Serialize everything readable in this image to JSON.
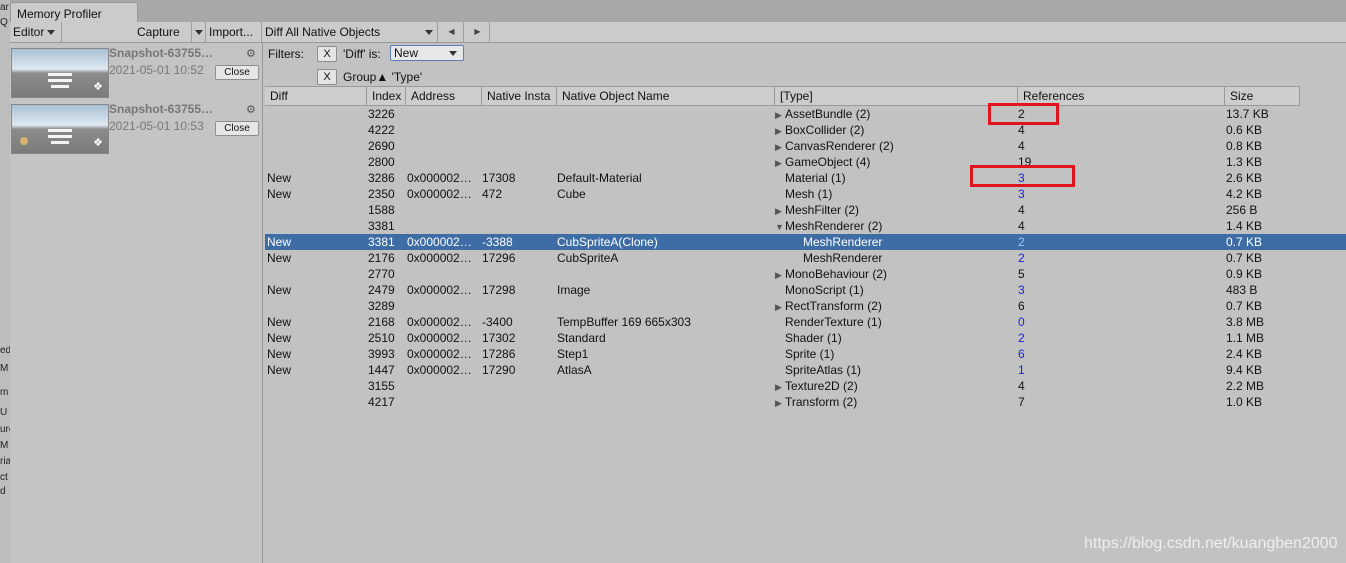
{
  "left_strip_fragments": [
    "ar",
    "Q",
    "ed",
    "M",
    "m",
    "U",
    "ure",
    "M",
    "ria",
    "ct",
    "d"
  ],
  "window": {
    "tab_title": "Memory Profiler"
  },
  "toolbar": {
    "editor_label": "Editor",
    "capture_label": "Capture",
    "import_label": "Import...",
    "view_select": "Diff All Native Objects",
    "prev_icon": "triangle-left-icon",
    "next_icon": "triangle-right-icon"
  },
  "snapshots": [
    {
      "name": "Snapshot-63755…",
      "date": "2021-05-01 10:52",
      "close_label": "Close"
    },
    {
      "name": "Snapshot-63755…",
      "date": "2021-05-01 10:53",
      "close_label": "Close"
    }
  ],
  "filters": {
    "label": "Filters:",
    "remove_label": "X",
    "diff_label": "'Diff' is:",
    "diff_value": "New",
    "group_label": "Group▲ 'Type'"
  },
  "table": {
    "columns": [
      "Diff",
      "Index",
      "Address",
      "Native Insta",
      "Native Object Name",
      "[Type]",
      "References",
      "Size"
    ],
    "rows": [
      {
        "diff": "",
        "index": "3226",
        "address": "",
        "instance": "",
        "name": "",
        "fold": "closed",
        "type": "AssetBundle (2)",
        "refs": "2",
        "size": "13.7 KB"
      },
      {
        "diff": "",
        "index": "4222",
        "address": "",
        "instance": "",
        "name": "",
        "fold": "closed",
        "type": "BoxCollider (2)",
        "refs": "4",
        "size": "0.6 KB"
      },
      {
        "diff": "",
        "index": "2690",
        "address": "",
        "instance": "",
        "name": "",
        "fold": "closed",
        "type": "CanvasRenderer (2)",
        "refs": "4",
        "size": "0.8 KB"
      },
      {
        "diff": "",
        "index": "2800",
        "address": "",
        "instance": "",
        "name": "",
        "fold": "closed",
        "type": "GameObject (4)",
        "refs": "19",
        "size": "1.3 KB"
      },
      {
        "diff": "New",
        "index": "3286",
        "address": "0x000002…",
        "instance": "17308",
        "name": "Default-Material",
        "fold": "",
        "type": "Material (1)",
        "refs": "3",
        "refs_link": true,
        "size": "2.6 KB"
      },
      {
        "diff": "New",
        "index": "2350",
        "address": "0x000002…",
        "instance": "472",
        "name": "Cube",
        "fold": "",
        "type": "Mesh (1)",
        "refs": "3",
        "refs_link": true,
        "size": "4.2 KB"
      },
      {
        "diff": "",
        "index": "1588",
        "address": "",
        "instance": "",
        "name": "",
        "fold": "closed",
        "type": "MeshFilter (2)",
        "refs": "4",
        "size": "256 B"
      },
      {
        "diff": "",
        "index": "3381",
        "address": "",
        "instance": "",
        "name": "",
        "fold": "open",
        "type": "MeshRenderer (2)",
        "refs": "4",
        "size": "1.4 KB"
      },
      {
        "diff": "New",
        "index": "3381",
        "address": "0x000002…",
        "instance": "-3388",
        "name": "CubSpriteA(Clone)",
        "fold": "child",
        "type": "MeshRenderer",
        "refs": "2",
        "refs_link": true,
        "size": "0.7 KB",
        "selected": true
      },
      {
        "diff": "New",
        "index": "2176",
        "address": "0x000002…",
        "instance": "17296",
        "name": "CubSpriteA",
        "fold": "child",
        "type": "MeshRenderer",
        "refs": "2",
        "refs_link": true,
        "size": "0.7 KB"
      },
      {
        "diff": "",
        "index": "2770",
        "address": "",
        "instance": "",
        "name": "",
        "fold": "closed",
        "type": "MonoBehaviour (2)",
        "refs": "5",
        "size": "0.9 KB"
      },
      {
        "diff": "New",
        "index": "2479",
        "address": "0x000002…",
        "instance": "17298",
        "name": "Image",
        "fold": "",
        "type": "MonoScript (1)",
        "refs": "3",
        "refs_link": true,
        "size": "483 B"
      },
      {
        "diff": "",
        "index": "3289",
        "address": "",
        "instance": "",
        "name": "",
        "fold": "closed",
        "type": "RectTransform (2)",
        "refs": "6",
        "size": "0.7 KB"
      },
      {
        "diff": "New",
        "index": "2168",
        "address": "0x000002…",
        "instance": "-3400",
        "name": "TempBuffer 169 665x303",
        "fold": "",
        "type": "RenderTexture (1)",
        "refs": "0",
        "refs_link": true,
        "size": "3.8 MB"
      },
      {
        "diff": "New",
        "index": "2510",
        "address": "0x000002…",
        "instance": "17302",
        "name": "Standard",
        "fold": "",
        "type": "Shader (1)",
        "refs": "2",
        "refs_link": true,
        "size": "1.1 MB"
      },
      {
        "diff": "New",
        "index": "3993",
        "address": "0x000002…",
        "instance": "17286",
        "name": "Step1",
        "fold": "",
        "type": "Sprite (1)",
        "refs": "6",
        "refs_link": true,
        "size": "2.4 KB"
      },
      {
        "diff": "New",
        "index": "1447",
        "address": "0x000002…",
        "instance": "17290",
        "name": "AtlasA",
        "fold": "",
        "type": "SpriteAtlas (1)",
        "refs": "1",
        "refs_link": true,
        "size": "9.4 KB"
      },
      {
        "diff": "",
        "index": "3155",
        "address": "",
        "instance": "",
        "name": "",
        "fold": "closed",
        "type": "Texture2D (2)",
        "refs": "4",
        "size": "2.2 MB"
      },
      {
        "diff": "",
        "index": "4217",
        "address": "",
        "instance": "",
        "name": "",
        "fold": "closed",
        "type": "Transform (2)",
        "refs": "7",
        "size": "1.0 KB"
      }
    ]
  },
  "colors": {
    "selection": "#3e6da6",
    "link": "#2323d8",
    "highlight_box": "#e0141c"
  },
  "watermark": "https://blog.csdn.net/kuangben2000"
}
